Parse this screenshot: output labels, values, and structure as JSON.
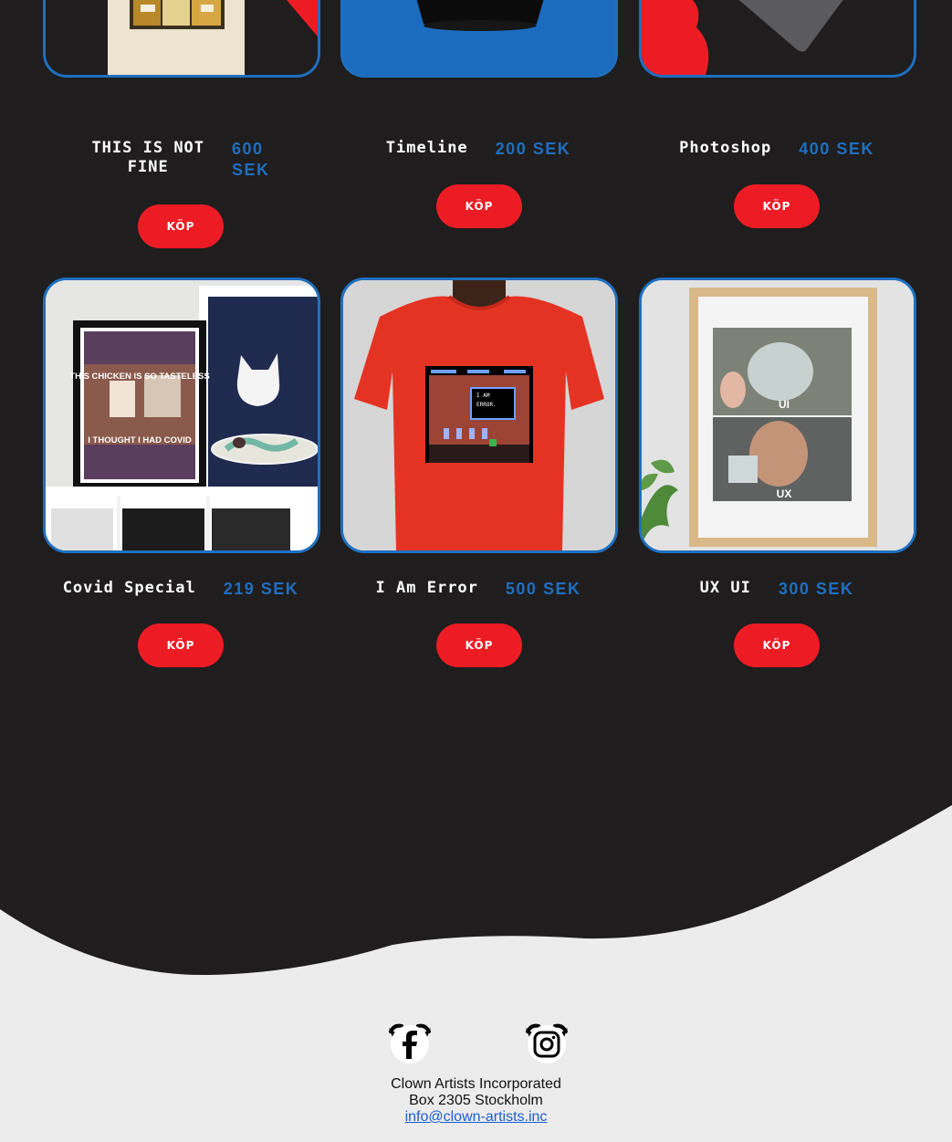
{
  "products_top": [
    {
      "name_line1": "THIS IS NOT",
      "name_line2": "FINE",
      "price_line1": "600",
      "price_line2": "SEK",
      "button": "KÖP"
    },
    {
      "name": "Timeline",
      "price": "200 SEK",
      "button": "KÖP"
    },
    {
      "name": "Photoshop",
      "price": "400 SEK",
      "button": "KÖP"
    }
  ],
  "products_mid": [
    {
      "name": "Covid Special",
      "price": "219 SEK",
      "button": "KÖP",
      "poster_top": "THIS CHICKEN IS SO TASTELESS",
      "poster_bottom": "I THOUGHT I HAD COVID"
    },
    {
      "name": "I Am Error",
      "price": "500 SEK",
      "button": "KÖP",
      "game_text_1": "I AM",
      "game_text_2": "ERROR."
    },
    {
      "name": "UX UI",
      "price": "300 SEK",
      "button": "KÖP",
      "meme_top": "UI",
      "meme_bottom": "UX"
    }
  ],
  "footer": {
    "company": "Clown Artists Incorporated",
    "address": "Box 2305 Stockholm",
    "email": "info@clown-artists.inc",
    "social": [
      "facebook-icon",
      "instagram-icon"
    ]
  },
  "colors": {
    "background": "#1f1d1e",
    "accent_blue": "#1e6fc0",
    "button_red": "#ed1c24",
    "footer_bg": "#ececec"
  }
}
